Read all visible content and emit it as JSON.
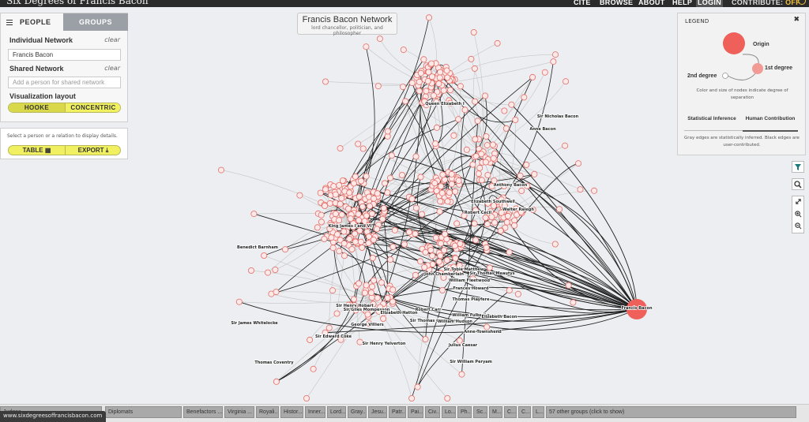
{
  "topbar": {
    "site_title": "Six Degrees of Francis Bacon",
    "nav": {
      "cite": "CITE",
      "browse": "BROWSE",
      "about": "ABOUT",
      "help": "HELP",
      "login": "LOGIN"
    },
    "contribute_label": "CONTRIBUTE: ",
    "contribute_state": "OFF"
  },
  "left_panel": {
    "tabs": {
      "people": "PEOPLE",
      "groups": "GROUPS"
    },
    "individual_label": "Individual Network",
    "individual_clear": "clear",
    "individual_value": "Francis Bacon",
    "shared_label": "Shared Network",
    "shared_clear": "clear",
    "shared_placeholder": "Add a person for shared network",
    "layout_label": "Visualization layout",
    "layout_options": {
      "hooke": "HOOKE",
      "concentric": "CONCENTRIC"
    },
    "detail_hint": "Select a person or a relation to display details.",
    "table_button": "TABLE ▦",
    "export_button": "EXPORT ⤓"
  },
  "network_header": {
    "title": "Francis Bacon Network",
    "subtitle": "lord chancellor, politician, and philosopher"
  },
  "legend": {
    "title": "LEGEND",
    "close": "✖",
    "origin": "Origin",
    "first_degree": "1st degree",
    "second_degree": "2nd degree",
    "size_note": "Color and size of nodes indicate degree of separation",
    "tabs": {
      "statistical": "Statistical Inference",
      "human": "Human Contribution"
    },
    "edge_note": "Gray edges are statistically inferred. Black edges are user-contributed.",
    "colors": {
      "origin": "#f0605a",
      "first": "#f29a94",
      "second": "#ffffff"
    }
  },
  "tools": {
    "filter_icon": "filter-icon",
    "search_icon": "search-icon",
    "expand_icon": "expand-icon",
    "zoom_in_icon": "zoom-in-icon",
    "zoom_out_icon": "zoom-out-icon"
  },
  "network": {
    "colors": {
      "origin": "#f0605a",
      "node_fill": "#fde9e8",
      "node_stroke": "#e36c67",
      "gray_edge": "#c4c4c4",
      "black_edge": "#222222"
    },
    "origin_label": "Francis Bacon",
    "labels": [
      "Queen Elizabeth I",
      "King James I and VI",
      "Sir Nicholas Bacon",
      "Anne Bacon",
      "Anthony Bacon",
      "Elizabeth Southwell",
      "Walter Ralegh",
      "Robert Cecil",
      "Benedict Barnham",
      "John Chamberlain",
      "Sir Tobie Matthew",
      "Sir Thomas Meautys",
      "William Fleetwood",
      "Frances Howard",
      "Thomas Playfere",
      "William Fulbecke",
      "Elizabeth Bacon",
      "Anne Townshend",
      "Robert Carr",
      "Sir Thomas Ove",
      "William Hudson",
      "Sir Henry Hobart",
      "Sir Giles Mompesson",
      "Elizabeth Hatton",
      "George Villiers",
      "Sir James Whitelocke",
      "Sir Edward Coke",
      "Sir Henry Yelverton",
      "Thomas Coventry",
      "Julius Caesar",
      "Sir William Peryam"
    ]
  },
  "group_bar": {
    "groups": [
      "Judges",
      "Diplomats",
      "Benefactors ...",
      "Virginia ...",
      "Royali...",
      "Histor...",
      "Inner...",
      "Lord...",
      "Gray...",
      "Jesu...",
      "Patr...",
      "Pai...",
      "Civ...",
      "Lo...",
      "Ph...",
      "Sc...",
      "M...",
      "C...",
      "C...",
      "L...",
      "57 other groups (click to show)"
    ],
    "status_url": "www.sixdegreesoffrancisbacon.com"
  }
}
